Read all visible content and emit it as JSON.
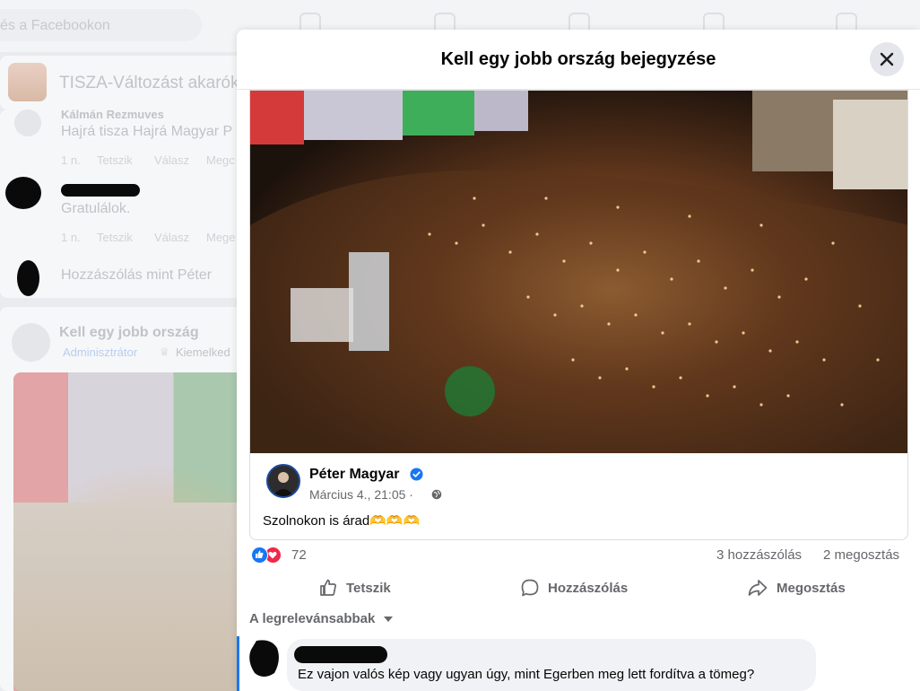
{
  "background": {
    "search_placeholder": "és a Facebookon",
    "group_name": "TISZA-Változást akarók",
    "comment1": {
      "author": "Kálmán Rezmuves",
      "text": "Hajrá tisza Hajrá Magyar P",
      "time": "1 n.",
      "like": "Tetszik",
      "reply": "Válasz",
      "share": "Megc"
    },
    "comment2": {
      "text": "Gratulálok.",
      "time": "1 n.",
      "like": "Tetszik",
      "reply": "Válasz",
      "share": "Mege"
    },
    "comment_input_placeholder": "Hozzászólás mint Péter",
    "post_author": "Kell egy jobb ország",
    "post_role": "Adminisztrátor",
    "post_badge": "Kiemelked"
  },
  "modal": {
    "title": "Kell egy jobb ország bejegyzése",
    "shared_post": {
      "author": "Péter Magyar",
      "date": "Március 4., 21:05 ·",
      "text": "Szolnokon is árad🫶🫶🫶"
    },
    "reactions": {
      "count": "72",
      "comments": "3 hozzászólás",
      "shares": "2 megosztás"
    },
    "actions": {
      "like": "Tetszik",
      "comment": "Hozzászólás",
      "share": "Megosztás"
    },
    "sort_label": "A legrelevánsabbak",
    "comment": {
      "text": "Ez vajon valós kép vagy ugyan úgy, mint Egerben meg lett fordítva a tömeg?"
    }
  },
  "colors": {
    "accent": "#1877f2",
    "love": "#f02849",
    "secondary_text": "#65676b"
  },
  "icons": [
    "close-icon",
    "verified-icon",
    "globe-icon",
    "like-reaction-icon",
    "love-reaction-icon",
    "thumbs-up-icon",
    "comment-icon",
    "share-icon",
    "caret-down-icon"
  ]
}
